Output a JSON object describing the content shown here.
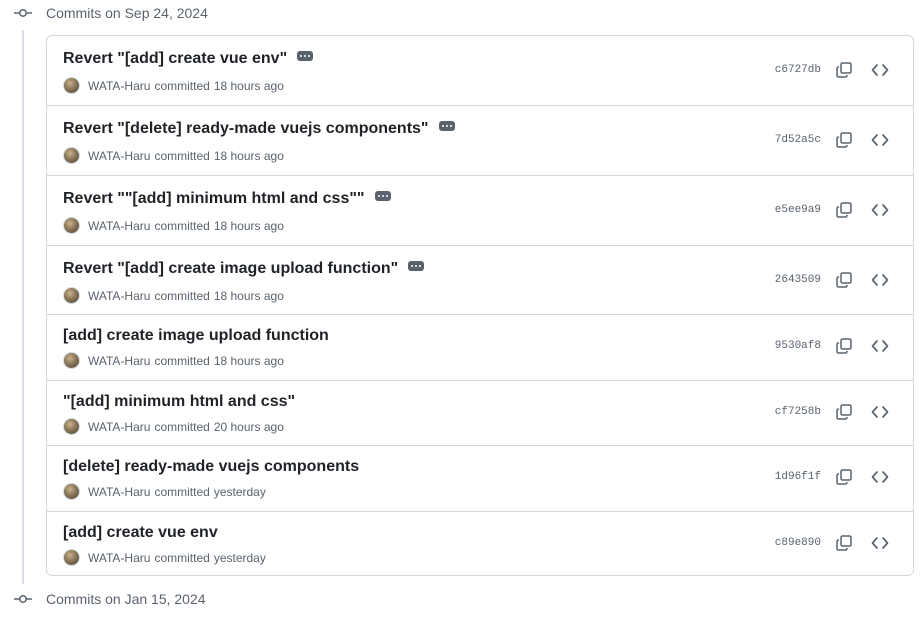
{
  "groups": [
    {
      "label": "Commits on Sep 24, 2024"
    },
    {
      "label": "Commits on Jan 15, 2024"
    }
  ],
  "commits": [
    {
      "title": "Revert \"[add] create vue env\"",
      "has_more": true,
      "author": "WATA-Haru",
      "committed": "committed",
      "time": "18 hours ago",
      "sha": "c6727db"
    },
    {
      "title": "Revert \"[delete] ready-made vuejs components\"",
      "has_more": true,
      "author": "WATA-Haru",
      "committed": "committed",
      "time": "18 hours ago",
      "sha": "7d52a5c"
    },
    {
      "title": "Revert \"\"[add] minimum html and css\"\"",
      "has_more": true,
      "author": "WATA-Haru",
      "committed": "committed",
      "time": "18 hours ago",
      "sha": "e5ee9a9"
    },
    {
      "title": "Revert \"[add] create image upload function\"",
      "has_more": true,
      "author": "WATA-Haru",
      "committed": "committed",
      "time": "18 hours ago",
      "sha": "2643509"
    },
    {
      "title": "[add] create image upload function",
      "has_more": false,
      "author": "WATA-Haru",
      "committed": "committed",
      "time": "18 hours ago",
      "sha": "9530af8"
    },
    {
      "title": "\"[add] minimum html and css\"",
      "has_more": false,
      "author": "WATA-Haru",
      "committed": "committed",
      "time": "20 hours ago",
      "sha": "cf7258b"
    },
    {
      "title": "[delete] ready-made vuejs components",
      "has_more": false,
      "author": "WATA-Haru",
      "committed": "committed",
      "time": "yesterday",
      "sha": "1d96f1f"
    },
    {
      "title": "[add] create vue env",
      "has_more": false,
      "author": "WATA-Haru",
      "committed": "committed",
      "time": "yesterday",
      "sha": "c89e890"
    }
  ],
  "icons": {
    "commit_node": "git-commit-icon",
    "more": "kebab-horizontal-icon",
    "copy": "copy-icon",
    "browse": "code-icon"
  },
  "colors": {
    "border": "#d1d9e0",
    "muted_text": "#59636e",
    "title_text": "#1f2328"
  }
}
